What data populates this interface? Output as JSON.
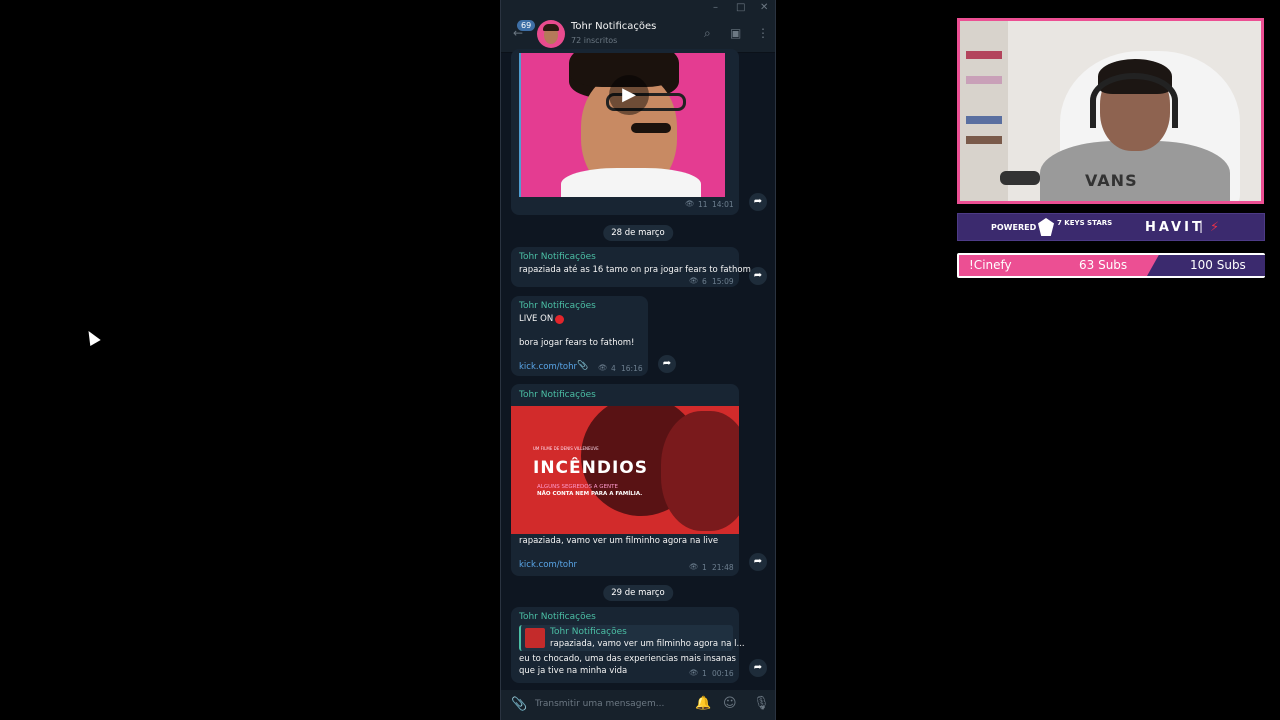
{
  "telegram": {
    "channel_title": "Tohr Notificações",
    "subscribers": "72 inscritos",
    "unread_count": "69",
    "input_placeholder": "Transmitir uma mensagem...",
    "messages": {
      "video": {
        "views": "11",
        "time": "14:01"
      },
      "date1": "28 de março",
      "msg1": {
        "sender": "Tohr Notificações",
        "text": "rapaziada até as 16 tamo on pra jogar fears to fathom",
        "views": "6",
        "time": "15:09"
      },
      "msg2": {
        "sender": "Tohr Notificações",
        "line1": "LIVE ON",
        "line2": "bora jogar fears to fathom!",
        "link": "kick.com/tohr",
        "views": "4",
        "time": "16:16"
      },
      "msg3": {
        "sender": "Tohr Notificações",
        "poster": {
          "credit": "UM FILME DE DENIS VILLENEUVE",
          "title": "INCÊNDIOS",
          "tagline1": "ALGUNS SEGREDOS A GENTE",
          "tagline2": "NÃO CONTA NEM PARA A FAMÍLIA."
        },
        "text": "rapaziada, vamo ver um filminho agora na live",
        "link": "kick.com/tohr",
        "views": "1",
        "time": "21:48"
      },
      "date2": "29 de março",
      "msg4": {
        "sender": "Tohr Notificações",
        "reply_sender": "Tohr Notificações",
        "reply_text": "rapaziada, vamo ver um filminho agora na l...",
        "line1": "eu to chocado, uma das experiencias mais insanas",
        "line2": "que ja tive na minha vida",
        "views": "1",
        "time": "00:16"
      }
    }
  },
  "overlay": {
    "powered_by": "POWERED BY",
    "sponsor1": "7 KEYS STARS",
    "sponsor2": "HAVIT",
    "sub_name": "!Cinefy",
    "sub_current": "63 Subs",
    "sub_goal": "100 Subs",
    "webcam_shirt_text": "VANS",
    "accent_color": "#ec4f93",
    "purple_color": "#3b2a6e"
  }
}
